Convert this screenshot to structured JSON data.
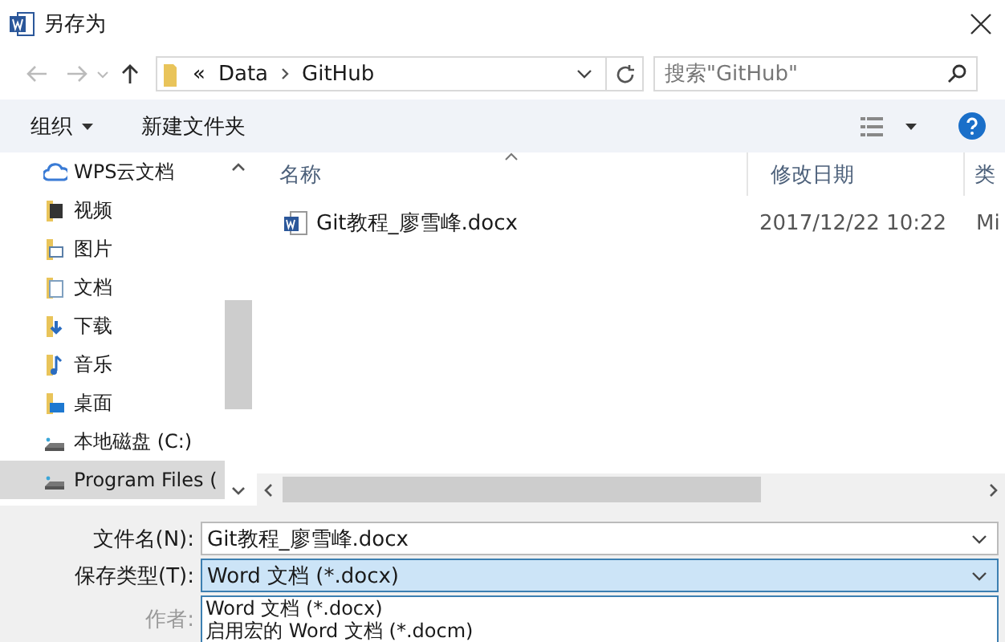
{
  "window": {
    "title": "另存为"
  },
  "address": {
    "overflow": "«",
    "path": [
      {
        "label": "Data"
      },
      {
        "label": "GitHub"
      }
    ]
  },
  "search": {
    "placeholder": "搜索\"GitHub\""
  },
  "toolbar": {
    "items": [
      {
        "label": "组织",
        "kind": "menu"
      },
      {
        "label": "新建文件夹",
        "kind": "button"
      }
    ]
  },
  "sidebar": {
    "items": [
      {
        "label": "WPS云文档",
        "kind": "cloud",
        "selected": false
      },
      {
        "label": "视频",
        "kind": "folder-video",
        "selected": false
      },
      {
        "label": "图片",
        "kind": "folder-picture",
        "selected": false
      },
      {
        "label": "文档",
        "kind": "folder-document",
        "selected": false
      },
      {
        "label": "下载",
        "kind": "folder-download",
        "selected": false
      },
      {
        "label": "音乐",
        "kind": "folder-music",
        "selected": false
      },
      {
        "label": "桌面",
        "kind": "folder-desktop",
        "selected": false
      },
      {
        "label": "本地磁盘 (C:)",
        "kind": "drive",
        "selected": false
      },
      {
        "label": "Program Files (",
        "kind": "drive",
        "selected": true
      }
    ]
  },
  "file_list": {
    "columns": [
      {
        "label": "名称",
        "sorted": true
      },
      {
        "label": "修改日期",
        "sorted": false
      },
      {
        "label": "类",
        "sorted": false
      }
    ],
    "rows": [
      {
        "name": "Git教程_廖雪峰.docx",
        "modified": "2017/12/22 10:22",
        "type": "Mi"
      }
    ]
  },
  "form": {
    "file_name": {
      "label": "文件名(N):",
      "value": "Git教程_廖雪峰.docx"
    },
    "save_type": {
      "label": "保存类型(T):",
      "value": "Word 文档 (*.docx)",
      "expanded": true
    },
    "options": [
      {
        "label": "Word 文档 (*.docx)"
      },
      {
        "label": "启用宏的 Word 文档 (*.docm)"
      }
    ],
    "author": {
      "label": "作者:"
    }
  }
}
